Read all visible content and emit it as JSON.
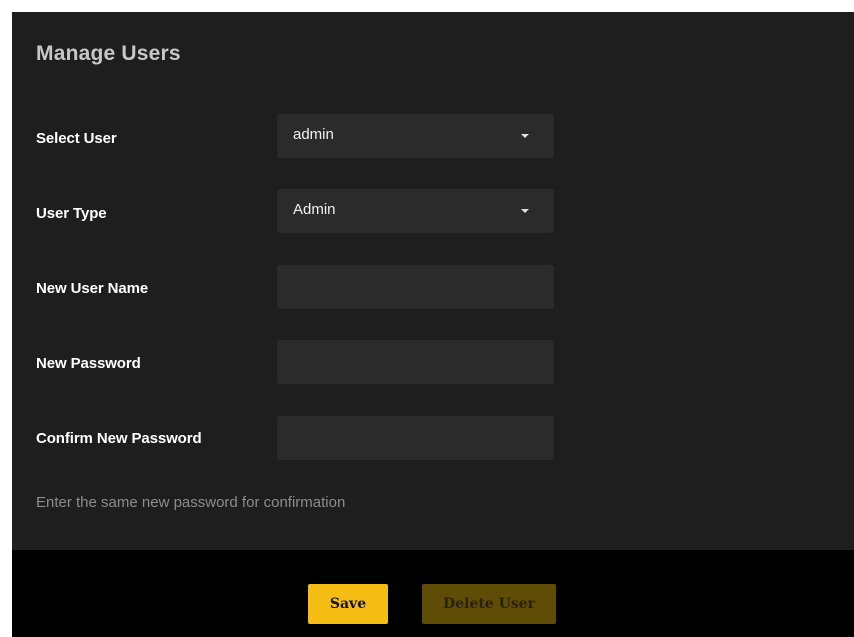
{
  "title": "Manage Users",
  "form": {
    "select_user": {
      "label": "Select User",
      "value": "admin"
    },
    "user_type": {
      "label": "User Type",
      "value": "Admin"
    },
    "new_user_name": {
      "label": "New User Name",
      "value": ""
    },
    "new_password": {
      "label": "New Password",
      "value": ""
    },
    "confirm_password": {
      "label": "Confirm New Password",
      "value": ""
    },
    "hint": "Enter the same new password for confirmation"
  },
  "buttons": {
    "save": "Save",
    "delete_user": "Delete User"
  },
  "colors": {
    "accent": "#f5bd14",
    "accent_disabled": "#5f4c06",
    "panel": "#1e1e1e",
    "field": "#2b2b2b"
  },
  "icons": {
    "dropdown": "caret-down-icon"
  }
}
